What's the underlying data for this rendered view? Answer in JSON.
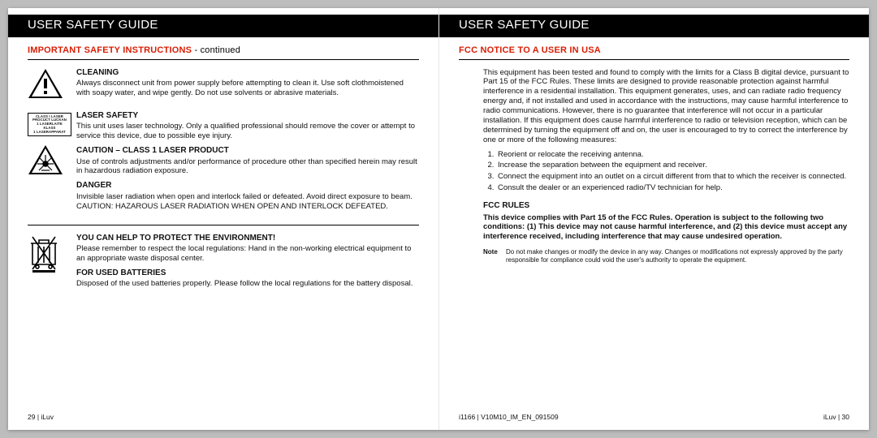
{
  "left": {
    "titlebar": "USER SAFETY GUIDE",
    "subhead_red": "IMPORTANT SAFETY INSTRUCTIONS",
    "subhead_cont": " - continued",
    "cleaning_h": "CLEANING",
    "cleaning": "Always disconnect unit from power supply before attempting to clean it. Use soft clothmoistened with soapy water, and wipe gently. Do not use solvents or abrasive materials.",
    "laserbox": "CLASS I LASER\nPROCUCT LUCKAN\n1 LASERLAITE\nKLASS\n1 LASERAPPARAT",
    "laser_h": "LASER SAFETY",
    "laser": "This unit uses laser technology. Only a qualified professional should remove the cover or attempt to service this device, due to possible eye injury.",
    "caution_h": "CAUTION – CLASS 1 LASER PRODUCT",
    "caution": "Use of controls adjustments and/or performance of procedure other than specified herein may result in hazardous radiation exposure.",
    "danger_h": "DANGER",
    "danger": "Invisible laser radiation when open and interlock failed or defeated.  Avoid direct exposure to beam. CAUTION: HAZAROUS LASER RADIATION WHEN OPEN AND INTERLOCK DEFEATED.",
    "env_h": "YOU CAN HELP TO PROTECT THE ENVIRONMENT!",
    "env": "Please remember to respect the local regulations: Hand in the non-working electrical equipment to an appropriate waste disposal center.",
    "bat_h": "FOR USED BATTERIES",
    "bat": "Disposed of the used batteries properly. Please follow the local regulations for the battery disposal.",
    "footer_l": "29 | iLuv"
  },
  "right": {
    "titlebar": "USER SAFETY GUIDE",
    "subhead_red": "FCC NOTICE TO A USER IN USA",
    "intro": "This equipment has been tested and found to comply with the limits for a Class B digital device, pursuant to Part 15 of the FCC Rules. These limits are designed to provide reasonable protection against harmful interference in a residential installation. This equipment generates, uses, and can radiate radio frequency energy and, if not installed and used in accordance with the instructions, may cause harmful interference to radio communications. However, there is no guarantee that interference will not occur in a particular installation. If this equipment does cause harmful interference to radio or television reception, which can be determined by turning the equipment off and on, the user is encouraged to try to correct the interference by one or more of the following measures:",
    "li1": "Reorient or relocate the receiving antenna.",
    "li2": "Increase the separation between the equipment and receiver.",
    "li3": "Connect the equipment into an outlet on a circuit different from that to which the receiver is connected.",
    "li4": "Consult the dealer or an experienced radio/TV technician for help.",
    "rules_h": "FCC RULES",
    "rules": "This device complies with Part 15 of the FCC Rules. Operation is subject to the following two conditions: (1) This device may not cause harmful interference, and (2) this device must accept any interference received, including interference that may cause undesired operation.",
    "note_l": "Note",
    "note": "Do not make changes or modify the device in any way. Changes or modifications not expressly approved by the party responsible for compliance could void the user's authority to operate the equipment.",
    "footer_l": "i1166 | V10M10_IM_EN_091509",
    "footer_r": "iLuv | 30"
  }
}
